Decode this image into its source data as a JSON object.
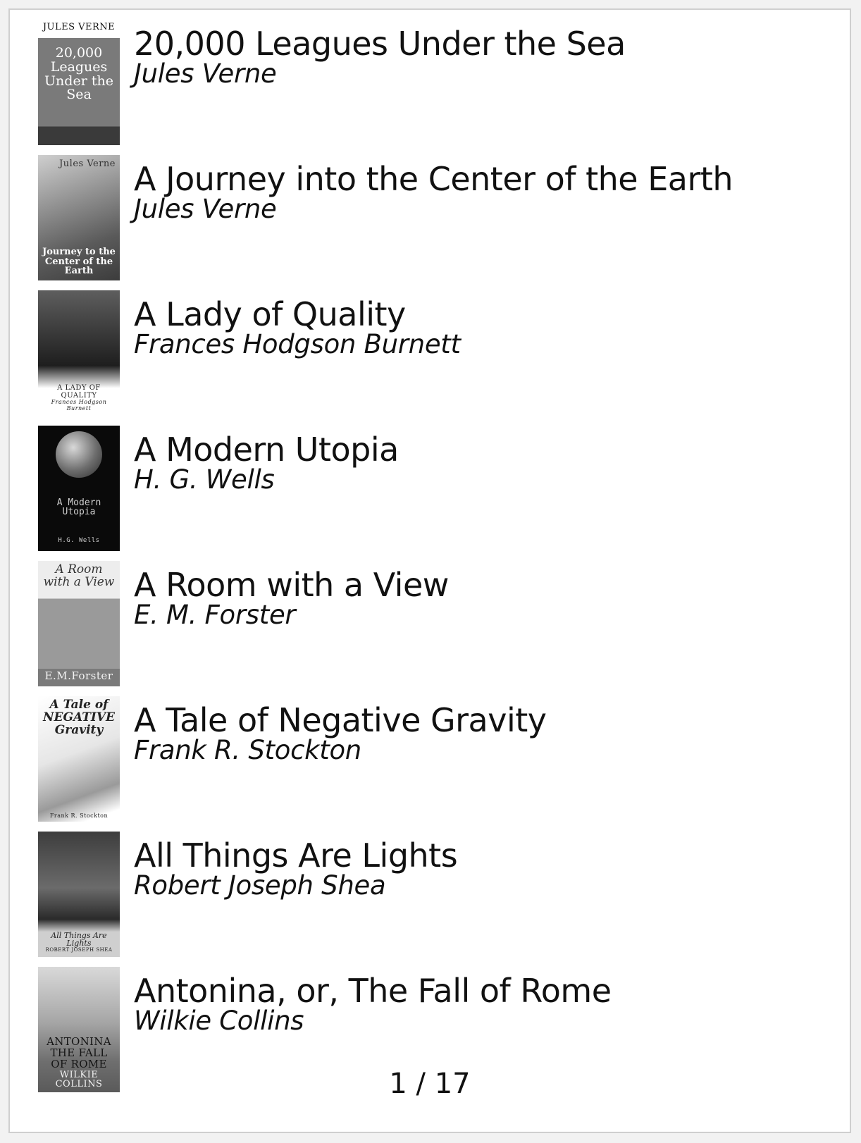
{
  "books": [
    {
      "title": "20,000 Leagues Under the Sea",
      "author": "Jules Verne",
      "cover_title": "20,000 Leagues Under the Sea",
      "cover_author": "JULES VERNE"
    },
    {
      "title": "A Journey into the Center of the Earth",
      "author": "Jules Verne",
      "cover_title": "Journey to the Center of the Earth",
      "cover_author": "Jules Verne"
    },
    {
      "title": "A Lady of Quality",
      "author": "Frances Hodgson Burnett",
      "cover_title": "A LADY OF QUALITY",
      "cover_author": "Frances Hodgson Burnett"
    },
    {
      "title": "A Modern Utopia",
      "author": "H. G. Wells",
      "cover_title": "A Modern Utopia",
      "cover_author": "H.G. Wells"
    },
    {
      "title": "A Room with a View",
      "author": "E. M. Forster",
      "cover_title": "A Room with a View",
      "cover_author": "E.M.Forster"
    },
    {
      "title": "A Tale of Negative Gravity",
      "author": "Frank R. Stockton",
      "cover_title": "A Tale of NEGATIVE Gravity",
      "cover_author": "Frank R. Stockton"
    },
    {
      "title": "All Things Are Lights",
      "author": "Robert Joseph Shea",
      "cover_title": "All Things Are Lights",
      "cover_author": "ROBERT JOSEPH SHEA"
    },
    {
      "title": "Antonina, or, The Fall of Rome",
      "author": "Wilkie Collins",
      "cover_title": "ANTONINA THE FALL OF ROME",
      "cover_author": "WILKIE COLLINS"
    }
  ],
  "pagination": {
    "label": "1 / 17",
    "current": 1,
    "total": 17
  }
}
